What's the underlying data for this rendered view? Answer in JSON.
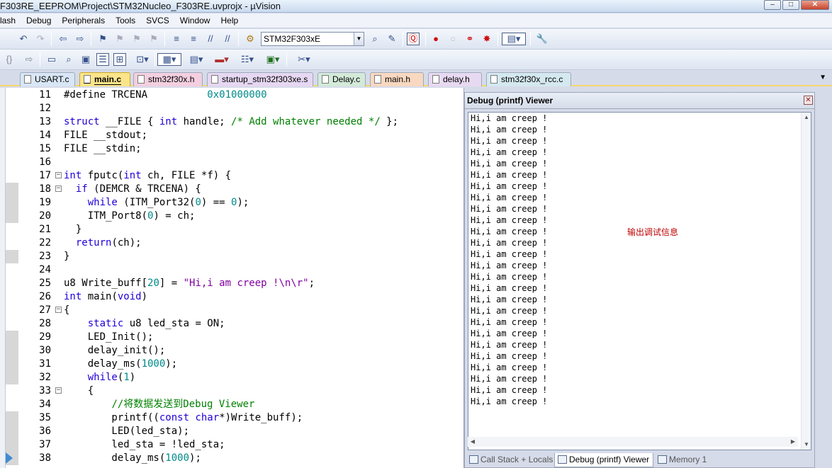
{
  "window": {
    "title": "F303RE_EEPROM\\Project\\STM32Nucleo_F303RE.uvprojx - µVision",
    "buttons": [
      "–",
      "□",
      "✕"
    ]
  },
  "menu": [
    "lash",
    "Debug",
    "Peripherals",
    "Tools",
    "SVCS",
    "Window",
    "Help"
  ],
  "toolbar": {
    "target": "STM32F303xE"
  },
  "tabs": [
    {
      "label": "USART.c",
      "color": "#d8e6f5"
    },
    {
      "label": "main.c",
      "color": "#fbe48a",
      "active": true
    },
    {
      "label": "stm32f30x.h",
      "color": "#f3cfe0"
    },
    {
      "label": "startup_stm32f303xe.s",
      "color": "#e6d7f2"
    },
    {
      "label": "Delay.c",
      "color": "#d3ead9"
    },
    {
      "label": "main.h",
      "color": "#f8d8c0"
    },
    {
      "label": "delay.h",
      "color": "#e8d9f2"
    },
    {
      "label": "stm32f30x_rcc.c",
      "color": "#d4e8ef"
    }
  ],
  "code": [
    {
      "n": "11",
      "t": [
        [
          "#define TRCENA          ",
          ""
        ],
        [
          "0x01000000",
          "num"
        ]
      ]
    },
    {
      "n": "12",
      "t": []
    },
    {
      "n": "13",
      "t": [
        [
          "struct",
          "kw"
        ],
        [
          " __FILE { ",
          ""
        ],
        [
          "int",
          "kw"
        ],
        [
          " handle; ",
          ""
        ],
        [
          "/* Add whatever needed */",
          "cmt"
        ],
        [
          " };",
          ""
        ]
      ]
    },
    {
      "n": "14",
      "t": [
        [
          "FILE __stdout;",
          ""
        ]
      ]
    },
    {
      "n": "15",
      "t": [
        [
          "FILE __stdin;",
          ""
        ]
      ]
    },
    {
      "n": "16",
      "t": []
    },
    {
      "n": "17",
      "fold": "−",
      "t": [
        [
          "int",
          "kw"
        ],
        [
          " fputc(",
          ""
        ],
        [
          "int",
          "kw"
        ],
        [
          " ch, FILE *f) {",
          ""
        ]
      ]
    },
    {
      "n": "18",
      "fold": "−",
      "mark": true,
      "t": [
        [
          "  ",
          ""
        ],
        [
          "if",
          "kw"
        ],
        [
          " (DEMCR & TRCENA) {",
          ""
        ]
      ]
    },
    {
      "n": "19",
      "mark": true,
      "t": [
        [
          "    ",
          ""
        ],
        [
          "while",
          "kw"
        ],
        [
          " (ITM_Port32(",
          ""
        ],
        [
          "0",
          "num"
        ],
        [
          ") == ",
          ""
        ],
        [
          "0",
          "num"
        ],
        [
          ");",
          ""
        ]
      ]
    },
    {
      "n": "20",
      "mark": true,
      "t": [
        [
          "    ITM_Port8(",
          ""
        ],
        [
          "0",
          "num"
        ],
        [
          ") = ch;",
          ""
        ]
      ]
    },
    {
      "n": "21",
      "t": [
        [
          "  }",
          ""
        ]
      ]
    },
    {
      "n": "22",
      "t": [
        [
          "  ",
          ""
        ],
        [
          "return",
          "kw"
        ],
        [
          "(ch);",
          ""
        ]
      ]
    },
    {
      "n": "23",
      "mark": true,
      "t": [
        [
          "}",
          ""
        ]
      ]
    },
    {
      "n": "24",
      "t": []
    },
    {
      "n": "25",
      "t": [
        [
          "u8 Write_buff[",
          ""
        ],
        [
          "20",
          "num"
        ],
        [
          "] = ",
          ""
        ],
        [
          "\"Hi,i am creep !\\n\\r\"",
          "str"
        ],
        [
          ";",
          ""
        ]
      ]
    },
    {
      "n": "26",
      "t": [
        [
          "int",
          "kw"
        ],
        [
          " main(",
          ""
        ],
        [
          "void",
          "kw"
        ],
        [
          ")",
          ""
        ]
      ]
    },
    {
      "n": "27",
      "fold": "−",
      "t": [
        [
          "{",
          ""
        ]
      ]
    },
    {
      "n": "28",
      "t": [
        [
          "    ",
          ""
        ],
        [
          "static",
          "kw"
        ],
        [
          " u8 led_sta = ON;",
          ""
        ]
      ]
    },
    {
      "n": "29",
      "mark": true,
      "t": [
        [
          "    LED_Init();",
          ""
        ]
      ]
    },
    {
      "n": "30",
      "mark": true,
      "t": [
        [
          "    delay_init();",
          ""
        ]
      ]
    },
    {
      "n": "31",
      "mark": true,
      "t": [
        [
          "    delay_ms(",
          ""
        ],
        [
          "1000",
          "num"
        ],
        [
          ");",
          ""
        ]
      ]
    },
    {
      "n": "32",
      "mark": true,
      "t": [
        [
          "    ",
          ""
        ],
        [
          "while",
          "kw"
        ],
        [
          "(",
          ""
        ],
        [
          "1",
          "num"
        ],
        [
          ")",
          ""
        ]
      ]
    },
    {
      "n": "33",
      "fold": "−",
      "t": [
        [
          "    {",
          ""
        ]
      ]
    },
    {
      "n": "34",
      "t": [
        [
          "        ",
          ""
        ],
        [
          "//将数据发送到Debug Viewer",
          "cmt"
        ]
      ]
    },
    {
      "n": "35",
      "mark": true,
      "t": [
        [
          "        printf((",
          ""
        ],
        [
          "const",
          "kw"
        ],
        [
          " ",
          ""
        ],
        [
          "char",
          "kw"
        ],
        [
          "*)Write_buff);",
          ""
        ]
      ]
    },
    {
      "n": "36",
      "mark": true,
      "t": [
        [
          "        LED(led_sta);",
          ""
        ]
      ]
    },
    {
      "n": "37",
      "mark": true,
      "t": [
        [
          "        led_sta = !led_sta;",
          ""
        ]
      ]
    },
    {
      "n": "38",
      "mark": true,
      "arrow": true,
      "t": [
        [
          "        delay_ms(",
          ""
        ],
        [
          "1000",
          "num"
        ],
        [
          ");",
          ""
        ]
      ]
    }
  ],
  "debug_viewer": {
    "title": "Debug (printf) Viewer",
    "line_text": "Hi,i am creep !",
    "line_count": 26,
    "annotation": "输出调试信息",
    "tabs": [
      "Call Stack + Locals",
      "Debug (printf) Viewer",
      "Memory 1"
    ]
  },
  "colors": {
    "keyword": "#1f00d8",
    "number": "#008a8a",
    "string": "#8000a0",
    "comment": "#008000",
    "annotation": "#c00000"
  }
}
